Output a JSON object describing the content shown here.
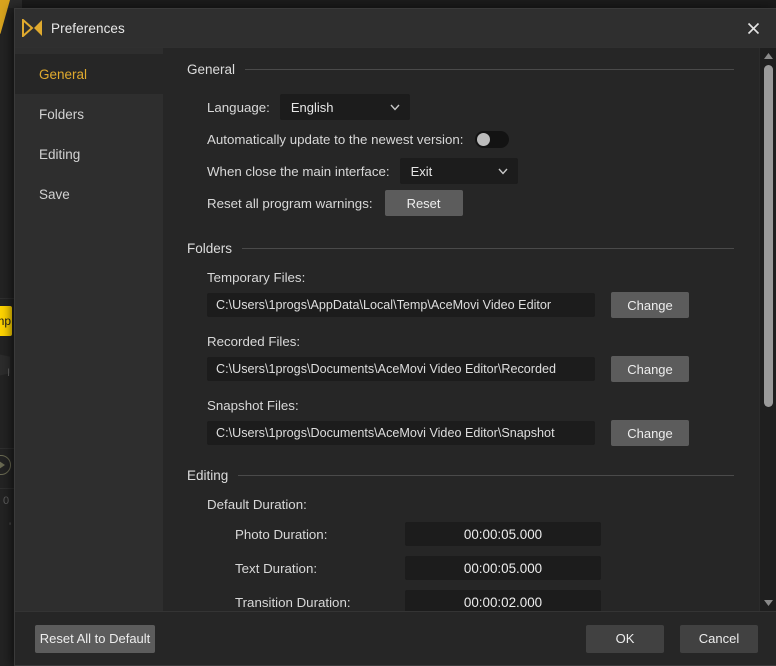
{
  "window": {
    "title": "Preferences",
    "logo_icon": "acemovi-logo-icon",
    "close_icon": "close-icon"
  },
  "colors": {
    "accent_gold": "#e0aa2e",
    "window_bg": "#262626",
    "sidebar_bg": "#2e2e2e",
    "titlebar_bg": "#2f2f2f",
    "field_bg": "#1c1c1c",
    "button_gray": "#5c5c5c",
    "scrollbar_thumb": "#9a9a9a"
  },
  "sidebar": {
    "items": [
      {
        "label": "General",
        "active": true
      },
      {
        "label": "Folders",
        "active": false
      },
      {
        "label": "Editing",
        "active": false
      },
      {
        "label": "Save",
        "active": false
      }
    ]
  },
  "sections": {
    "general": {
      "heading": "General",
      "language": {
        "label": "Language:",
        "value": "English",
        "caret_icon": "chevron-down-icon",
        "options": [
          "English"
        ]
      },
      "auto_update": {
        "label": "Automatically update to the newest version:",
        "state": "off"
      },
      "on_close": {
        "label": "When close the main interface:",
        "value": "Exit",
        "caret_icon": "chevron-down-icon",
        "options": [
          "Exit"
        ]
      },
      "reset_warnings": {
        "label": "Reset all program warnings:",
        "button_label": "Reset"
      }
    },
    "folders": {
      "heading": "Folders",
      "change_button_label": "Change",
      "entries": [
        {
          "label": "Temporary Files:",
          "path": "C:\\Users\\1progs\\AppData\\Local\\Temp\\AceMovi Video Editor"
        },
        {
          "label": "Recorded Files:",
          "path": "C:\\Users\\1progs\\Documents\\AceMovi Video Editor\\Recorded"
        },
        {
          "label": "Snapshot Files:",
          "path": "C:\\Users\\1progs\\Documents\\AceMovi Video Editor\\Snapshot"
        }
      ]
    },
    "editing": {
      "heading": "Editing",
      "default_duration_label": "Default Duration:",
      "durations": [
        {
          "label": "Photo Duration:",
          "value": "00:00:05.000"
        },
        {
          "label": "Text Duration:",
          "value": "00:00:05.000"
        },
        {
          "label": "Transition Duration:",
          "value": "00:00:02.000"
        }
      ]
    }
  },
  "scrollbar": {
    "up_arrow_icon": "caret-up-icon",
    "down_arrow_icon": "caret-down-icon"
  },
  "footer": {
    "reset_all_label": "Reset All to Default",
    "ok_label": "OK",
    "cancel_label": "Cancel"
  },
  "backdrop": {
    "yellow_button_text": "mp"
  }
}
